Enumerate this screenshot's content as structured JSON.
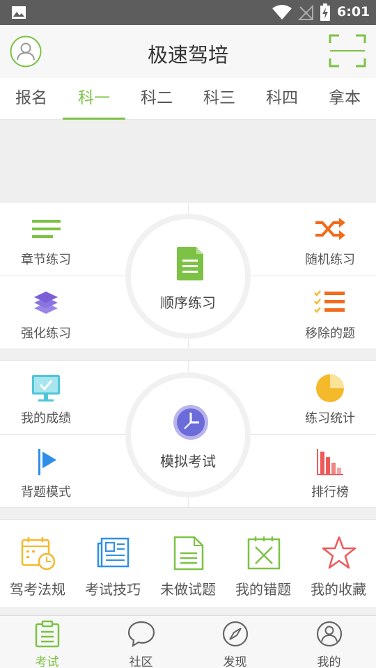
{
  "status_bar": {
    "time": "6:01"
  },
  "app_bar": {
    "title": "极速驾培"
  },
  "tabs": [
    {
      "label": "报名"
    },
    {
      "label": "科一",
      "active": true
    },
    {
      "label": "科二"
    },
    {
      "label": "科三"
    },
    {
      "label": "科四"
    },
    {
      "label": "拿本"
    }
  ],
  "practice": {
    "center": "顺序练习",
    "top_left": "章节练习",
    "top_right": "随机练习",
    "bottom_left": "强化练习",
    "bottom_right": "移除的题"
  },
  "exam": {
    "center": "模拟考试",
    "top_left": "我的成绩",
    "top_right": "练习统计",
    "bottom_left": "背题模式",
    "bottom_right": "排行榜"
  },
  "tools": [
    {
      "label": "驾考法规",
      "icon": "calendar-clock-icon"
    },
    {
      "label": "考试技巧",
      "icon": "newspaper-icon"
    },
    {
      "label": "未做试题",
      "icon": "document-icon"
    },
    {
      "label": "我的错题",
      "icon": "wrong-box-icon"
    },
    {
      "label": "我的收藏",
      "icon": "star-icon"
    }
  ],
  "bottom_nav": [
    {
      "label": "考试",
      "active": true
    },
    {
      "label": "社区"
    },
    {
      "label": "发现"
    },
    {
      "label": "我的"
    }
  ],
  "colors": {
    "accent": "#7cc244",
    "status_bar": "#5d5d5d",
    "orange": "#f26b1d",
    "purple": "#7b5fd6",
    "blue": "#2f8fe8",
    "yellow": "#f5b92c",
    "red": "#ee5a5a",
    "cyan": "#4fc6d8"
  }
}
